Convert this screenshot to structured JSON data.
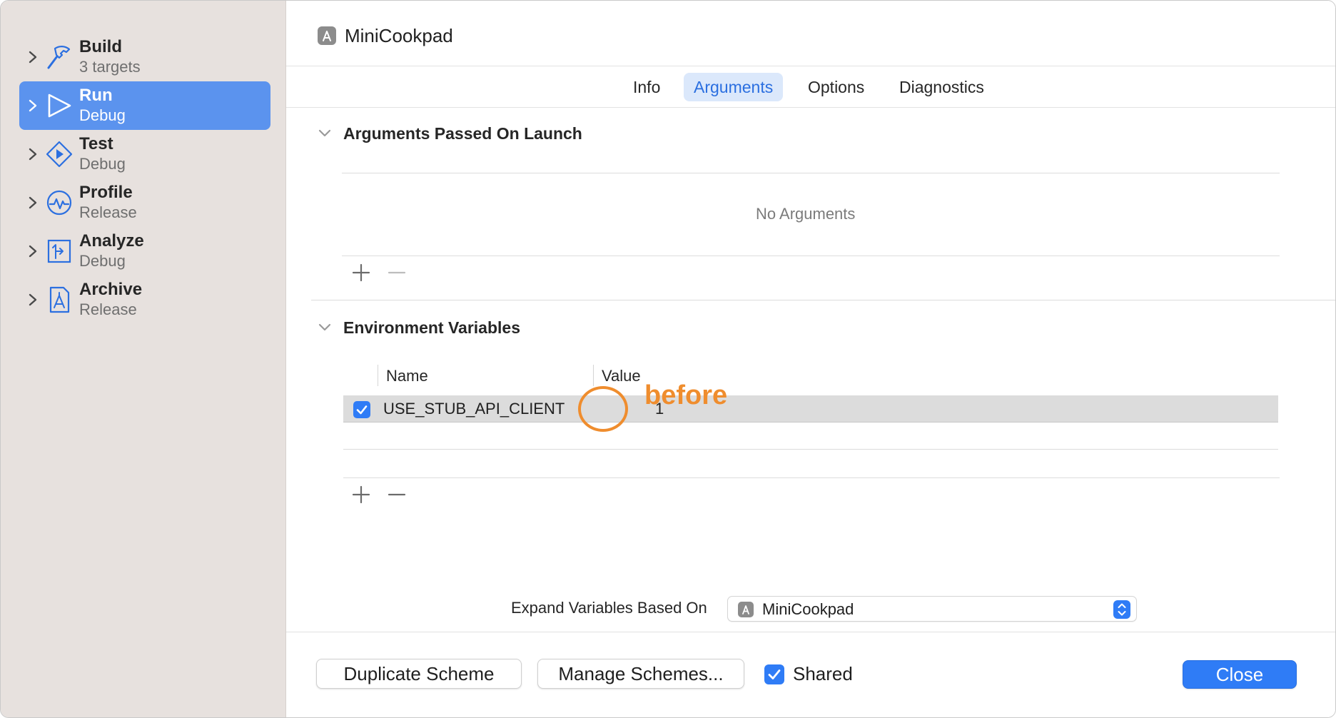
{
  "sidebar": {
    "items": [
      {
        "title": "Build",
        "subtitle": "3 targets",
        "icon": "hammer-icon",
        "selected": false
      },
      {
        "title": "Run",
        "subtitle": "Debug",
        "icon": "play-icon",
        "selected": true
      },
      {
        "title": "Test",
        "subtitle": "Debug",
        "icon": "test-diamond-icon",
        "selected": false
      },
      {
        "title": "Profile",
        "subtitle": "Release",
        "icon": "profile-gauge-icon",
        "selected": false
      },
      {
        "title": "Analyze",
        "subtitle": "Debug",
        "icon": "analyze-icon",
        "selected": false
      },
      {
        "title": "Archive",
        "subtitle": "Release",
        "icon": "archive-icon",
        "selected": false
      }
    ]
  },
  "header": {
    "title": "MiniCookpad"
  },
  "tabs": [
    {
      "label": "Info",
      "active": false
    },
    {
      "label": "Arguments",
      "active": true
    },
    {
      "label": "Options",
      "active": false
    },
    {
      "label": "Diagnostics",
      "active": false
    }
  ],
  "arguments_section": {
    "title": "Arguments Passed On Launch",
    "empty_text": "No Arguments"
  },
  "env_section": {
    "title": "Environment Variables",
    "columns": {
      "name": "Name",
      "value": "Value"
    },
    "rows": [
      {
        "enabled": true,
        "name": "USE_STUB_API_CLIENT",
        "value": "1"
      }
    ]
  },
  "annotation": {
    "label": "before",
    "color": "#ef8d2e"
  },
  "expand": {
    "label": "Expand Variables Based On",
    "selected": "MiniCookpad"
  },
  "footer": {
    "duplicate_label": "Duplicate Scheme",
    "manage_label": "Manage Schemes...",
    "shared_label": "Shared",
    "shared_checked": true,
    "close_label": "Close"
  },
  "colors": {
    "accent": "#2f7cf6",
    "sidebar_selected": "#5b93ee",
    "sidebar_bg": "#e7e1de"
  }
}
